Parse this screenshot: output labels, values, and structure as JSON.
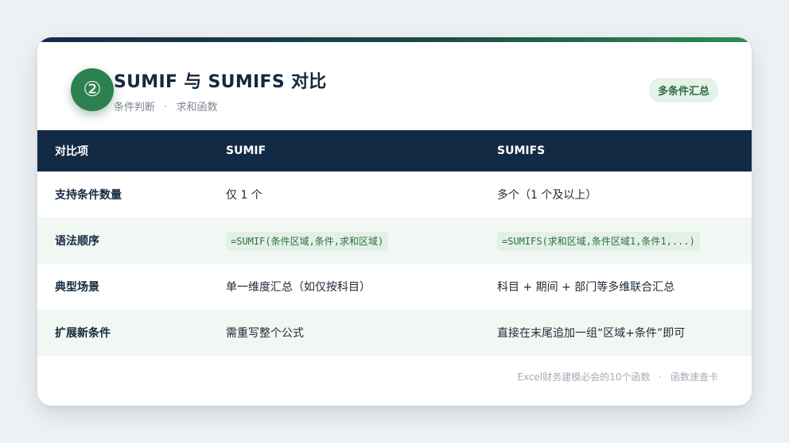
{
  "header": {
    "number_badge": "②",
    "title": "SUMIF 与 SUMIFS 对比",
    "subtitle_parts": [
      "条件判断",
      "求和函数"
    ],
    "separator": "·",
    "tag": "多条件汇总"
  },
  "table": {
    "columns": [
      "对比项",
      "SUMIF",
      "SUMIFS"
    ],
    "rows": [
      {
        "item": "支持条件数量",
        "sumif": "仅 1 个",
        "sumifs": "多个（1 个及以上）"
      },
      {
        "item": "语法顺序",
        "sumif": "=SUMIF(条件区域,条件,求和区域)",
        "sumifs": "=SUMIFS(求和区域,条件区域1,条件1,...)"
      },
      {
        "item": "典型场景",
        "sumif": "单一维度汇总（如仅按科目）",
        "sumifs": "科目 + 期间 + 部门等多维联合汇总"
      },
      {
        "item": "扩展新条件",
        "sumif": "需重写整个公式",
        "sumifs": "直接在末尾追加一组“区域+条件”即可"
      }
    ]
  },
  "footer": {
    "source": "Excel财务建模必会的10个函数",
    "separator": "·",
    "label": "函数速查卡"
  },
  "colors": {
    "header_bg": "#132a45",
    "accent_green": "#2d8150",
    "tag_bg": "#e5f2e8",
    "stripe_bg": "#f1f7f2"
  }
}
